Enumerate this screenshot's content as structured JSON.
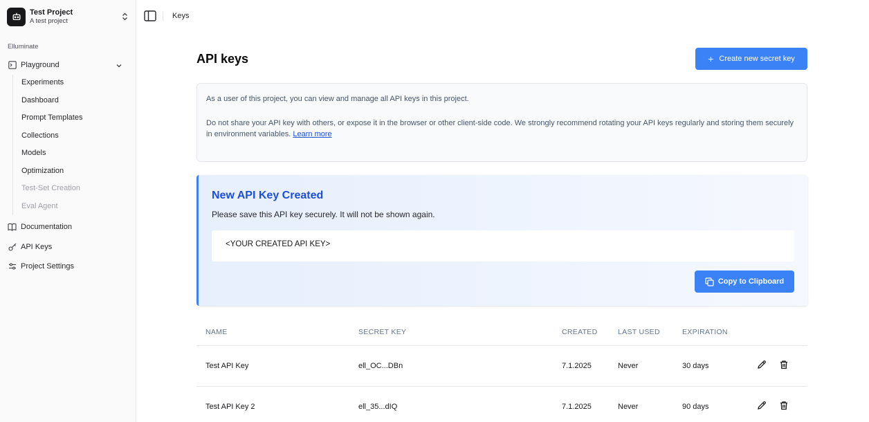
{
  "sidebar": {
    "project_name": "Test Project",
    "project_subtitle": "A test project",
    "section_label": "Elluminate",
    "playground_label": "Playground",
    "sub_items": [
      "Experiments",
      "Dashboard",
      "Prompt Templates",
      "Collections",
      "Models",
      "Optimization",
      "Test-Set Creation",
      "Eval Agent"
    ],
    "disabled_items": [
      "Test-Set Creation",
      "Eval Agent"
    ],
    "documentation_label": "Documentation",
    "api_keys_label": "API Keys",
    "project_settings_label": "Project Settings"
  },
  "topbar": {
    "breadcrumb": "Keys"
  },
  "page": {
    "title": "API keys",
    "create_button": "Create new secret key",
    "info_line1": "As a user of this project, you can view and manage all API keys in this project.",
    "info_line2": "Do not share your API key with others, or expose it in the browser or other client-side code. We strongly recommend rotating your API keys regularly and storing them securely in environment variables.",
    "learn_more": "Learn more"
  },
  "new_key": {
    "title": "New API Key Created",
    "description": "Please save this API key securely. It will not be shown again.",
    "key_value": "<YOUR CREATED API KEY>",
    "copy_button": "Copy to Clipboard"
  },
  "table": {
    "headers": {
      "name": "NAME",
      "secret": "SECRET KEY",
      "created": "CREATED",
      "last_used": "LAST USED",
      "expiration": "EXPIRATION"
    },
    "rows": [
      {
        "name": "Test API Key",
        "secret": "ell_OC...DBn",
        "created": "7.1.2025",
        "last_used": "Never",
        "expiration": "30 days"
      },
      {
        "name": "Test API Key 2",
        "secret": "ell_35...dIQ",
        "created": "7.1.2025",
        "last_used": "Never",
        "expiration": "90 days"
      }
    ]
  },
  "colors": {
    "accent": "#3b82f6",
    "title_blue": "#1d4ed8"
  },
  "icons": [
    "robot-icon",
    "chevron-updown-icon",
    "terminal-icon",
    "chevron-down-icon",
    "book-icon",
    "key-icon",
    "settings-sliders-icon",
    "sidebar-toggle-icon",
    "plus-icon",
    "copy-icon",
    "pencil-icon",
    "trash-icon"
  ]
}
